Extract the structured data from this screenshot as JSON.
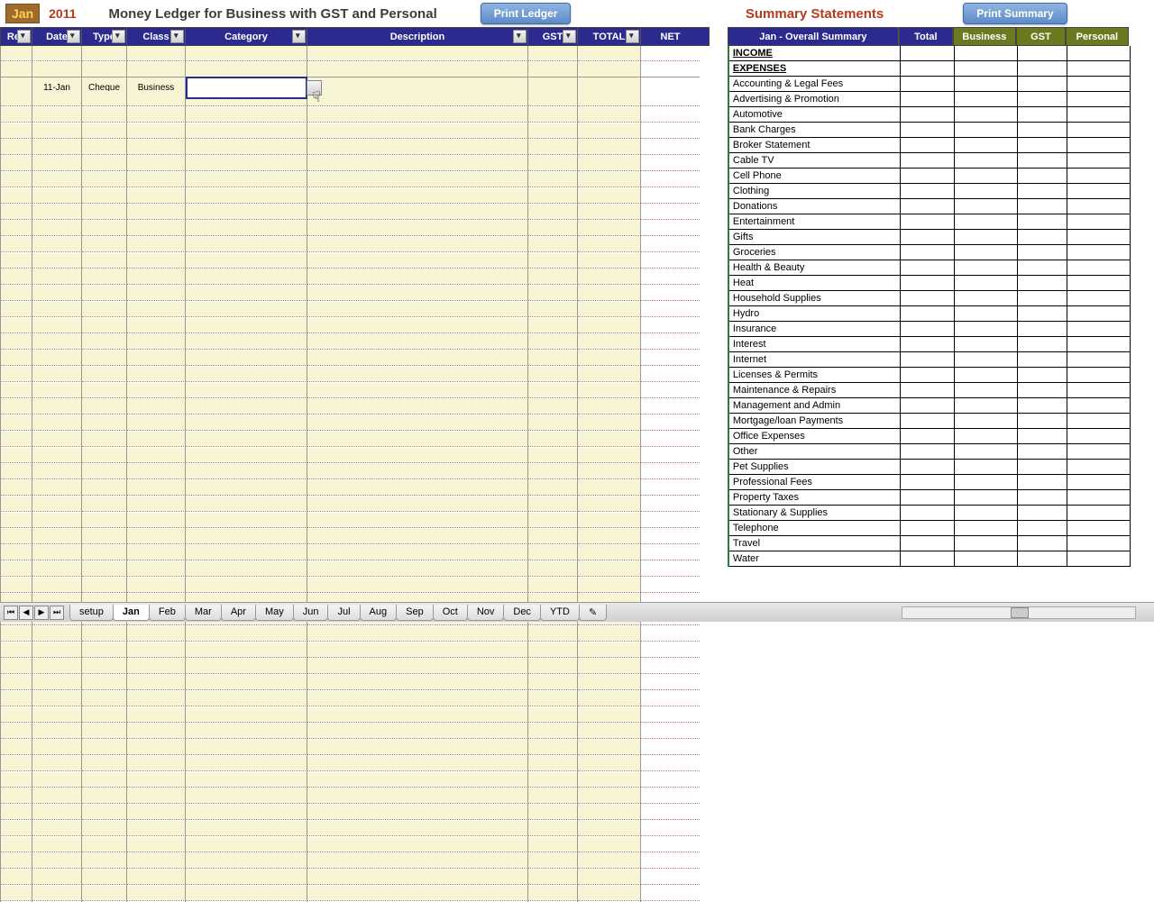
{
  "header": {
    "month": "Jan",
    "year": "2011",
    "title": "Money Ledger for Business with GST and Personal",
    "print_ledger": "Print Ledger",
    "summary_title": "Summary Statements",
    "print_summary": "Print Summary"
  },
  "ledger_columns": {
    "rec": "Rec",
    "date": "Date",
    "type": "Type",
    "class": "Class",
    "category": "Category",
    "description": "Description",
    "gst": "GST",
    "total": "TOTAL",
    "net": "NET"
  },
  "ledger_row": {
    "date": "11-Jan",
    "type": "Cheque",
    "class": "Business",
    "category": "",
    "description": "",
    "gst": "",
    "total": "",
    "net": ""
  },
  "summary_columns": {
    "main": "Jan - Overall Summary",
    "total": "Total",
    "business": "Business",
    "gst": "GST",
    "personal": "Personal"
  },
  "summary_rows": [
    {
      "label": "INCOME",
      "bold": true,
      "underline": true
    },
    {
      "label": "EXPENSES",
      "bold": true,
      "underline": true
    },
    {
      "label": "Accounting & Legal Fees"
    },
    {
      "label": "Advertising & Promotion"
    },
    {
      "label": "Automotive"
    },
    {
      "label": "Bank Charges"
    },
    {
      "label": "Broker Statement"
    },
    {
      "label": "Cable TV"
    },
    {
      "label": "Cell Phone"
    },
    {
      "label": "Clothing"
    },
    {
      "label": "Donations"
    },
    {
      "label": "Entertainment"
    },
    {
      "label": "Gifts"
    },
    {
      "label": "Groceries"
    },
    {
      "label": "Health & Beauty"
    },
    {
      "label": "Heat"
    },
    {
      "label": "Household Supplies"
    },
    {
      "label": "Hydro"
    },
    {
      "label": "Insurance"
    },
    {
      "label": "Interest"
    },
    {
      "label": "Internet"
    },
    {
      "label": "Licenses & Permits"
    },
    {
      "label": "Maintenance & Repairs"
    },
    {
      "label": "Management and Admin"
    },
    {
      "label": "Mortgage/loan Payments"
    },
    {
      "label": "Office Expenses"
    },
    {
      "label": "Other"
    },
    {
      "label": "Pet Supplies"
    },
    {
      "label": "Professional Fees"
    },
    {
      "label": "Property Taxes"
    },
    {
      "label": "Stationary & Supplies"
    },
    {
      "label": "Telephone"
    },
    {
      "label": "Travel"
    },
    {
      "label": "Water"
    }
  ],
  "tabs": [
    "setup",
    "Jan",
    "Feb",
    "Mar",
    "Apr",
    "May",
    "Jun",
    "Jul",
    "Aug",
    "Sep",
    "Oct",
    "Nov",
    "Dec",
    "YTD"
  ],
  "active_tab": "Jan"
}
